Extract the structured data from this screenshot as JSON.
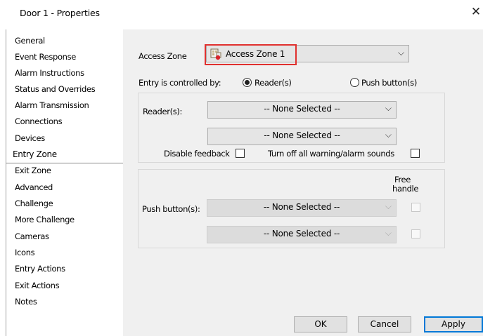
{
  "window": {
    "title": "Door 1 - Properties",
    "close_glyph": "✕"
  },
  "sidebar": {
    "items": [
      "General",
      "Event Response",
      "Alarm Instructions",
      "Status and Overrides",
      "Alarm Transmission",
      "Connections",
      "Devices",
      "Entry Zone",
      "Exit Zone",
      "Advanced",
      "Challenge",
      "More Challenge",
      "Cameras",
      "Icons",
      "Entry Actions",
      "Exit Actions",
      "Notes"
    ],
    "selected": "Entry Zone"
  },
  "access_zone": {
    "label": "Access Zone",
    "value": "Access Zone 1",
    "icon": "access-zone-icon",
    "highlight_color": "#e0302e"
  },
  "entry_control": {
    "label": "Entry is controlled by:",
    "options": [
      "Reader(s)",
      "Push button(s)"
    ],
    "selected": "Reader(s)"
  },
  "readers": {
    "label": "Reader(s):",
    "reader1": "-- None Selected --",
    "reader2": "-- None Selected --",
    "disable_feedback_label": "Disable feedback",
    "disable_feedback_checked": false,
    "turn_off_sounds_label": "Turn off all warning/alarm sounds",
    "turn_off_sounds_checked": false
  },
  "push_buttons": {
    "label": "Push button(s):",
    "free_handle_label_line1": "Free",
    "free_handle_label_line2": "handle",
    "button1": "-- None Selected --",
    "button2": "-- None Selected --"
  },
  "buttons": {
    "ok": "OK",
    "cancel": "Cancel",
    "apply": "Apply"
  },
  "chevron_glyph": "⌵",
  "colors": {
    "panel_bg": "#f0f0f0",
    "accent": "#0078d7"
  }
}
